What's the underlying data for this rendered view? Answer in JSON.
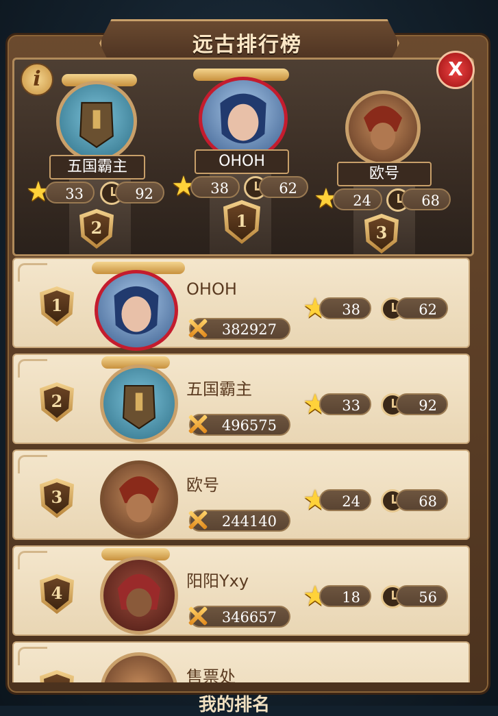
{
  "title": "远古排行榜",
  "top3": [
    {
      "rank_label": "2",
      "name": "五国霸主",
      "stars": "33",
      "time": "92"
    },
    {
      "rank_label": "1",
      "name": "OHOH",
      "stars": "38",
      "time": "62"
    },
    {
      "rank_label": "3",
      "name": "欧号",
      "stars": "24",
      "time": "68"
    }
  ],
  "rows": [
    {
      "rank": "1",
      "name": "OHOH",
      "power": "382927",
      "stars": "38",
      "time": "62"
    },
    {
      "rank": "2",
      "name": "五国霸主",
      "power": "496575",
      "stars": "33",
      "time": "92"
    },
    {
      "rank": "3",
      "name": "欧号",
      "power": "244140",
      "stars": "24",
      "time": "68"
    },
    {
      "rank": "4",
      "name": "阳阳Yxy",
      "power": "346657",
      "stars": "18",
      "time": "56"
    },
    {
      "rank": "",
      "name": "售票处",
      "power": "",
      "stars": "",
      "time": ""
    }
  ],
  "icons": {
    "info": "i",
    "close": "X",
    "star": "★"
  },
  "my_rank_label": "我的排名",
  "colors": {
    "frame": "#4b321e",
    "row_bg": "#f1e2c6",
    "accent_gold": "#c9a06a",
    "close_red": "#c41c2e"
  }
}
